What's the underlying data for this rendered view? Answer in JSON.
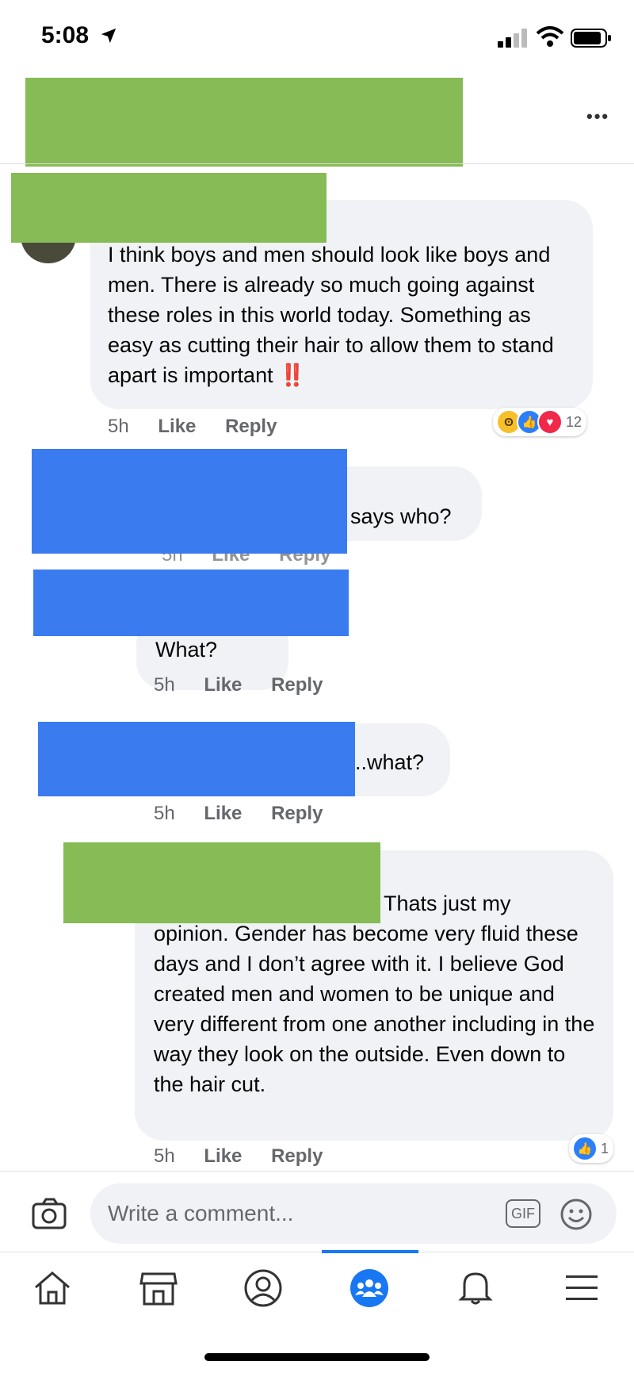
{
  "status_bar": {
    "time": "5:08"
  },
  "comments": [
    {
      "text": "I think boys and men should look like boys and men. There is already so much going against these roles in this world today. Something as easy as cutting their hair to allow them to stand apart is important",
      "emoji": "‼️",
      "time": "5h",
      "like": "Like",
      "reply": "Reply",
      "reaction_count": "12"
    },
    {
      "text": "says who?",
      "time": "5h",
      "like": "Like",
      "reply": "Reply"
    },
    {
      "text": "What?",
      "time": "5h",
      "like": "Like",
      "reply": "Reply"
    },
    {
      "text": "..what?",
      "time": "5h",
      "like": "Like",
      "reply": "Reply"
    },
    {
      "text_line1": "Thats just my",
      "text_rest": "opinion. Gender has become very fluid these days and I don’t agree with it. I believe God created men and women to be unique and very different from one another including in the way they look on the outside. Even down to the hair cut.",
      "time": "5h",
      "like": "Like",
      "reply": "Reply",
      "reaction_count": "1"
    }
  ],
  "composer": {
    "placeholder": "Write a comment...",
    "gif_label": "GIF"
  },
  "colors": {
    "accent": "#1877f2",
    "bubble": "#f0f2f5",
    "redaction_green": "#86bb56",
    "redaction_blue": "#3a7cf0"
  },
  "icons": [
    "location-arrow-icon",
    "signal-icon",
    "wifi-icon",
    "battery-icon",
    "more-icon",
    "camera-icon",
    "gif-icon",
    "emoji-icon",
    "home-icon",
    "marketplace-icon",
    "profile-icon",
    "groups-icon",
    "bell-icon",
    "menu-icon"
  ]
}
